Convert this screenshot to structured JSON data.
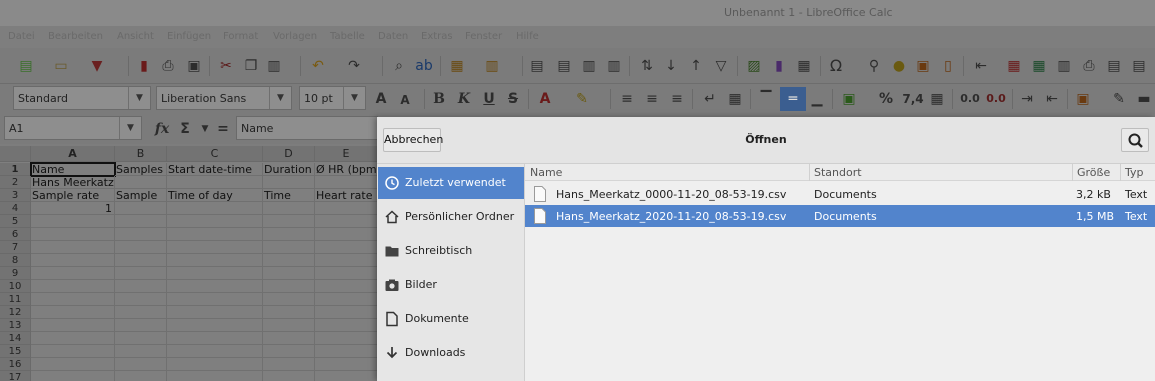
{
  "window": {
    "title": "Unbenannt 1 - LibreOffice Calc"
  },
  "menubar": [
    "Datei",
    "Bearbeiten",
    "Ansicht",
    "Einfügen",
    "Format",
    "Vorlagen",
    "Tabelle",
    "Daten",
    "Extras",
    "Fenster",
    "Hilfe"
  ],
  "toolbar2": {
    "style": "Standard",
    "font": "Liberation Sans",
    "size": "10 pt",
    "percent": "%",
    "decimal": "7,4",
    "dec_add": "0.0",
    "dec_del": "0.0"
  },
  "formulabar": {
    "cell_ref": "A1",
    "fx": "fx",
    "sigma": "Σ",
    "equals": "=",
    "content": "Name"
  },
  "grid": {
    "columns": [
      "A",
      "B",
      "C",
      "D",
      "E"
    ],
    "rows": [
      "1",
      "2",
      "3",
      "4",
      "5",
      "6",
      "7",
      "8",
      "9",
      "10",
      "11",
      "12",
      "13",
      "14",
      "15",
      "16",
      "17"
    ],
    "cells": {
      "A1": "Name",
      "B1": "Samples",
      "C1": "Start date-time",
      "D1": "Duration",
      "E1": "Ø HR (bpm",
      "A2": "Hans Meerkatz",
      "A3": "Sample rate",
      "B3": "Sample",
      "C3": "Time of day",
      "D3": "Time",
      "E3": "Heart rate",
      "A4": "1"
    }
  },
  "dialog": {
    "title": "Öffnen",
    "cancel_label": "Abbrechen",
    "places": [
      {
        "label": "Zuletzt verwendet",
        "icon": "clock-icon",
        "selected": true
      },
      {
        "label": "Persönlicher Ordner",
        "icon": "home-icon",
        "selected": false
      },
      {
        "label": "Schreibtisch",
        "icon": "folder-icon",
        "selected": false
      },
      {
        "label": "Bilder",
        "icon": "camera-icon",
        "selected": false
      },
      {
        "label": "Dokumente",
        "icon": "document-icon",
        "selected": false
      },
      {
        "label": "Downloads",
        "icon": "download-icon",
        "selected": false
      }
    ],
    "columns": {
      "name": "Name",
      "location": "Standort",
      "size": "Größe",
      "type": "Typ"
    },
    "files": [
      {
        "name": "Hans_Meerkatz_0000-11-20_08-53-19.csv",
        "location": "Documents",
        "size": "3,2 kB",
        "type": "Text",
        "selected": false
      },
      {
        "name": "Hans_Meerkatz_2020-11-20_08-53-19.csv",
        "location": "Documents",
        "size": "1,5 MB",
        "type": "Text",
        "selected": true
      }
    ]
  },
  "colors": {
    "selection": "#5284cc",
    "dim_overlay": "#7d7d7d"
  }
}
